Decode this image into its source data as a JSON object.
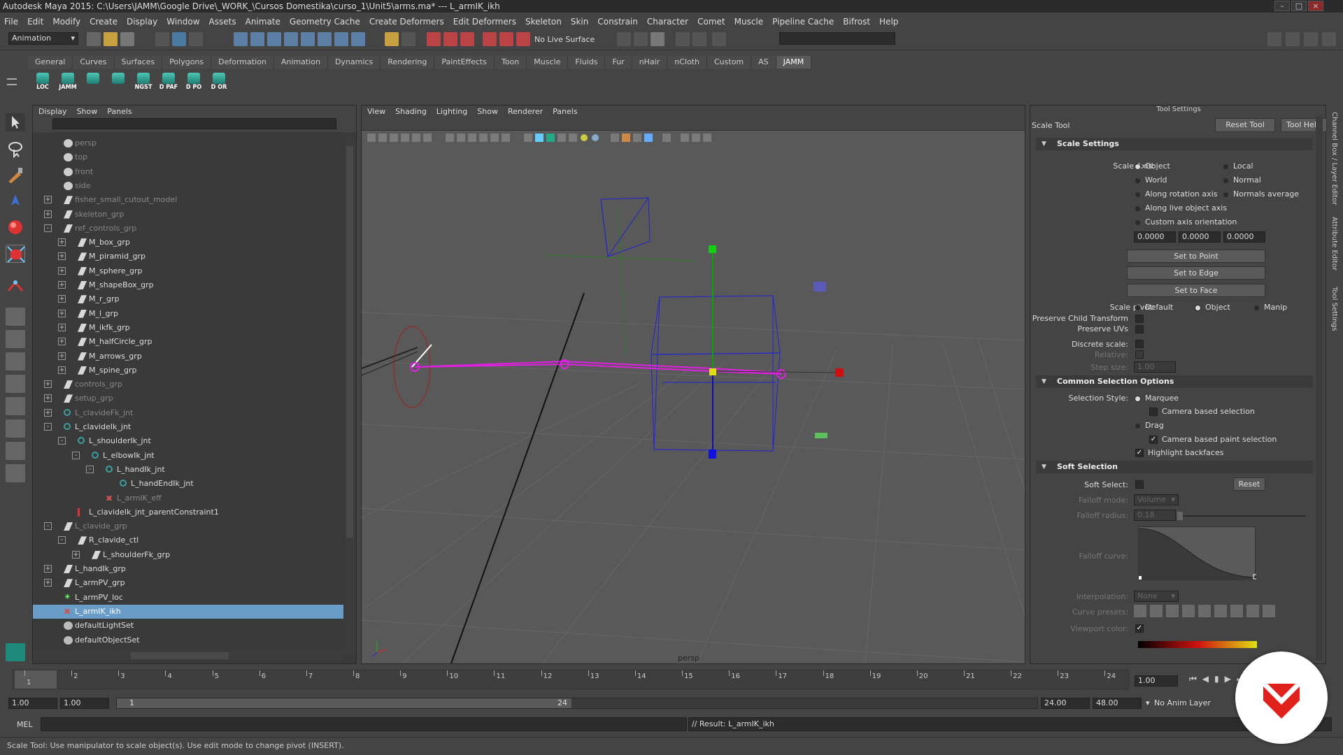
{
  "window": {
    "title": "Autodesk Maya 2015: C:\\Users\\JAMM\\Google Drive\\_WORK_\\Cursos Domestika\\curso_1\\Unit5\\arms.ma*   ---   L_armIK_ikh"
  },
  "menubar": [
    "File",
    "Edit",
    "Modify",
    "Create",
    "Display",
    "Window",
    "Assets",
    "Animate",
    "Geometry Cache",
    "Create Deformers",
    "Edit Deformers",
    "Skeleton",
    "Skin",
    "Constrain",
    "Character",
    "Comet",
    "Muscle",
    "Pipeline Cache",
    "Bifrost",
    "Help"
  ],
  "statusline": {
    "mode": "Animation",
    "live_surface": "No Live Surface"
  },
  "shelf": {
    "tabs": [
      "General",
      "Curves",
      "Surfaces",
      "Polygons",
      "Deformation",
      "Animation",
      "Dynamics",
      "Rendering",
      "PaintEffects",
      "Toon",
      "Muscle",
      "Fluids",
      "Fur",
      "nHair",
      "nCloth",
      "Custom",
      "AS",
      "JAMM"
    ],
    "active_tab": "JAMM",
    "buttons": [
      "LOC",
      "JAMM",
      "",
      "",
      "NGST",
      "D PAF",
      "D PO",
      "D OR"
    ]
  },
  "outliner": {
    "menu": [
      "Display",
      "Show",
      "Panels"
    ],
    "rows": [
      {
        "label": "persp",
        "type": "cam",
        "level": 0,
        "exp": "",
        "dim": true
      },
      {
        "label": "top",
        "type": "cam",
        "level": 0,
        "exp": "",
        "dim": true
      },
      {
        "label": "front",
        "type": "cam",
        "level": 0,
        "exp": "",
        "dim": true
      },
      {
        "label": "side",
        "type": "cam",
        "level": 0,
        "exp": "",
        "dim": true
      },
      {
        "label": "fisher_small_cutout_model",
        "type": "tx",
        "level": 0,
        "exp": "+",
        "dim": true
      },
      {
        "label": "skeleton_grp",
        "type": "tx",
        "level": 0,
        "exp": "+",
        "dim": true
      },
      {
        "label": "ref_controls_grp",
        "type": "tx",
        "level": 0,
        "exp": "-",
        "dim": true
      },
      {
        "label": "M_box_grp",
        "type": "tx",
        "level": 1,
        "exp": "+",
        "dim": false
      },
      {
        "label": "M_piramid_grp",
        "type": "tx",
        "level": 1,
        "exp": "+",
        "dim": false
      },
      {
        "label": "M_sphere_grp",
        "type": "tx",
        "level": 1,
        "exp": "+",
        "dim": false
      },
      {
        "label": "M_shapeBox_grp",
        "type": "tx",
        "level": 1,
        "exp": "+",
        "dim": false
      },
      {
        "label": "M_r_grp",
        "type": "tx",
        "level": 1,
        "exp": "+",
        "dim": false
      },
      {
        "label": "M_l_grp",
        "type": "tx",
        "level": 1,
        "exp": "+",
        "dim": false
      },
      {
        "label": "M_ikfk_grp",
        "type": "tx",
        "level": 1,
        "exp": "+",
        "dim": false
      },
      {
        "label": "M_halfCircle_grp",
        "type": "tx",
        "level": 1,
        "exp": "+",
        "dim": false
      },
      {
        "label": "M_arrows_grp",
        "type": "tx",
        "level": 1,
        "exp": "+",
        "dim": false
      },
      {
        "label": "M_spine_grp",
        "type": "tx",
        "level": 1,
        "exp": "+",
        "dim": false
      },
      {
        "label": "controls_grp",
        "type": "tx",
        "level": 0,
        "exp": "+",
        "dim": true
      },
      {
        "label": "setup_grp",
        "type": "tx",
        "level": 0,
        "exp": "+",
        "dim": true
      },
      {
        "label": "L_clavideFk_jnt",
        "type": "jnt",
        "level": 0,
        "exp": "+",
        "dim": true
      },
      {
        "label": "L_clavideIk_jnt",
        "type": "jnt",
        "level": 0,
        "exp": "-",
        "dim": false
      },
      {
        "label": "L_shoulderIk_jnt",
        "type": "jnt",
        "level": 1,
        "exp": "-",
        "dim": false
      },
      {
        "label": "L_elbowIk_jnt",
        "type": "jnt",
        "level": 2,
        "exp": "-",
        "dim": false
      },
      {
        "label": "L_handIk_jnt",
        "type": "jnt",
        "level": 3,
        "exp": "-",
        "dim": false
      },
      {
        "label": "L_handEndIk_jnt",
        "type": "jnt",
        "level": 4,
        "exp": "",
        "dim": false
      },
      {
        "label": "L_armIK_eff",
        "type": "eff",
        "level": 3,
        "exp": "",
        "dim": true
      },
      {
        "label": "L_clavideIk_jnt_parentConstraint1",
        "type": "cns",
        "level": 1,
        "exp": "",
        "dim": false
      },
      {
        "label": "L_clavide_grp",
        "type": "tx",
        "level": 0,
        "exp": "-",
        "dim": true
      },
      {
        "label": "R_clavide_ctl",
        "type": "crv",
        "level": 1,
        "exp": "-",
        "dim": false
      },
      {
        "label": "L_shoulderFk_grp",
        "type": "tx",
        "level": 2,
        "exp": "+",
        "dim": false
      },
      {
        "label": "L_handIk_grp",
        "type": "tx",
        "level": 0,
        "exp": "+",
        "dim": false
      },
      {
        "label": "L_armPV_grp",
        "type": "tx",
        "level": 0,
        "exp": "+",
        "dim": false
      },
      {
        "label": "L_armPV_loc",
        "type": "loc",
        "level": 0,
        "exp": "",
        "dim": false
      },
      {
        "label": "L_armIK_ikh",
        "type": "ikh",
        "level": 0,
        "exp": "",
        "dim": false,
        "selected": true
      },
      {
        "label": "defaultLightSet",
        "type": "set",
        "level": 0,
        "exp": "",
        "dim": false
      },
      {
        "label": "defaultObjectSet",
        "type": "set",
        "level": 0,
        "exp": "",
        "dim": false
      }
    ]
  },
  "viewport": {
    "menu": [
      "View",
      "Shading",
      "Lighting",
      "Show",
      "Renderer",
      "Panels"
    ],
    "camera": "persp"
  },
  "tool_settings": {
    "title": "Tool Settings",
    "tool_name": "Scale Tool",
    "reset_tool": "Reset Tool",
    "tool_help": "Tool Help",
    "scale_settings": {
      "header": "Scale Settings",
      "scale_axis_label": "Scale Axis:",
      "axis_options": [
        "Object",
        "Local",
        "World",
        "Normal",
        "Along rotation axis",
        "Normals average",
        "Along live object axis",
        "Custom axis orientation"
      ],
      "axis_selected": "Object",
      "vector": [
        "0.0000",
        "0.0000",
        "0.0000"
      ],
      "set_to_point": "Set to Point",
      "set_to_edge": "Set to Edge",
      "set_to_face": "Set to Face",
      "scale_pivot_label": "Scale pivot:",
      "pivot_options": [
        "Default",
        "Object",
        "Manip"
      ],
      "pivot_selected": "Object",
      "preserve_child": "Preserve Child Transform",
      "preserve_uvs": "Preserve UVs",
      "discrete_scale": "Discrete scale:",
      "relative": "Relative:",
      "step_size": "Step size:",
      "step_size_value": "1.00"
    },
    "common_selection": {
      "header": "Common Selection Options",
      "selection_style_label": "Selection Style:",
      "marquee": "Marquee",
      "camera_based_selection": "Camera based selection",
      "drag": "Drag",
      "camera_based_paint": "Camera based paint selection",
      "highlight_backfaces": "Highlight backfaces"
    },
    "soft_selection": {
      "header": "Soft Selection",
      "soft_select_label": "Soft Select:",
      "reset": "Reset",
      "falloff_mode_label": "Falloff mode:",
      "falloff_mode_value": "Volume",
      "falloff_radius_label": "Falloff radius:",
      "falloff_radius_value": "0.18",
      "falloff_curve_label": "Falloff curve:",
      "interpolation_label": "Interpolation:",
      "interpolation_value": "None",
      "curve_presets_label": "Curve presets:",
      "viewport_color_label": "Viewport color:"
    }
  },
  "side_tabs": [
    "Channel Box / Layer Editor",
    "Attribute Editor",
    "Tool Settings"
  ],
  "timeslider": {
    "ticks": [
      "1",
      "2",
      "3",
      "4",
      "5",
      "6",
      "7",
      "8",
      "9",
      "10",
      "11",
      "12",
      "13",
      "14",
      "15",
      "16",
      "17",
      "18",
      "19",
      "20",
      "21",
      "22",
      "23",
      "24"
    ],
    "current_frame": "1.00"
  },
  "rangeslider": {
    "start": "1.00",
    "start_inner": "1.00",
    "range_start": "1",
    "range_end": "24",
    "end_inner": "24.00",
    "end": "48.00",
    "anim_layer": "No Anim Layer"
  },
  "commandline": {
    "lang": "MEL",
    "result": "// Result: L_armIK_ikh"
  },
  "helpline": "Scale Tool: Use manipulator to scale object(s). Use edit mode to change pivot (INSERT).",
  "colors": {
    "selection": "#6a9cc8",
    "ik_chain": "#e020e0",
    "manip_x": "#e01010",
    "manip_y": "#10d010",
    "manip_z": "#1010e0",
    "badge": "#e0201a"
  }
}
